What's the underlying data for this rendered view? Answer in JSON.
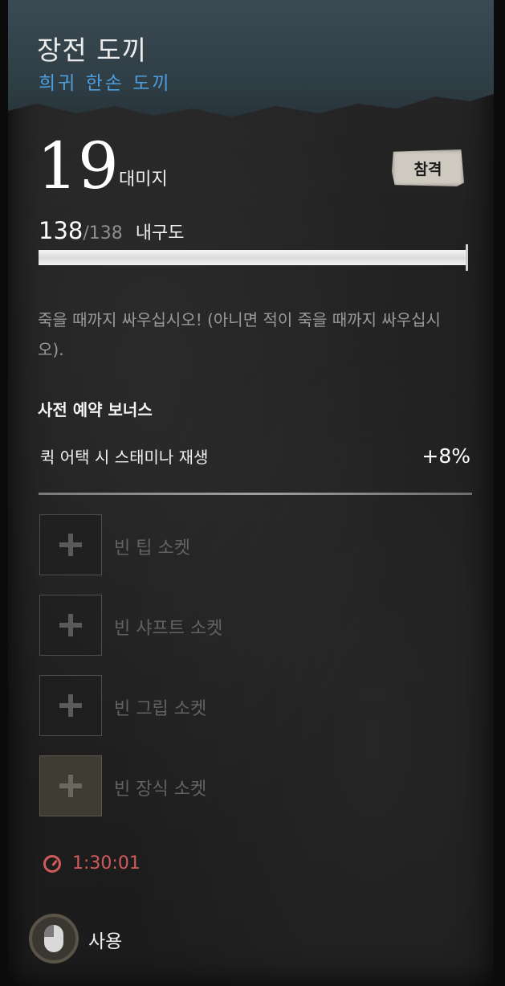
{
  "item": {
    "name": "장전 도끼",
    "rarity_type": "희귀 한손 도끼",
    "rarity_color": "#4c9ede"
  },
  "damage": {
    "value": "19",
    "label": "대미지",
    "type_badge": "참격"
  },
  "durability": {
    "current": "138",
    "max": "/138",
    "label": "내구도",
    "fill_fraction": 1.0
  },
  "flavor_text": "죽을 때까지 싸우십시오! (아니면 적이 죽을 때까지 싸우십시오).",
  "bonus": {
    "heading": "사전 예약 보너스",
    "rows": [
      {
        "name": "퀵 어택 시 스태미나 재생",
        "value": "+8%"
      }
    ]
  },
  "sockets": [
    {
      "label": "빈 팁 소켓",
      "icon": "plus-icon"
    },
    {
      "label": "빈 샤프트 소켓",
      "icon": "plus-icon"
    },
    {
      "label": "빈 그립 소켓",
      "icon": "plus-icon"
    },
    {
      "label": "빈 장식 소켓",
      "icon": "plus-icon"
    }
  ],
  "timer": {
    "text": "1:30:01",
    "color": "#cf5b5b"
  },
  "action": {
    "label": "사용",
    "icon": "mouse-left-click-icon"
  }
}
